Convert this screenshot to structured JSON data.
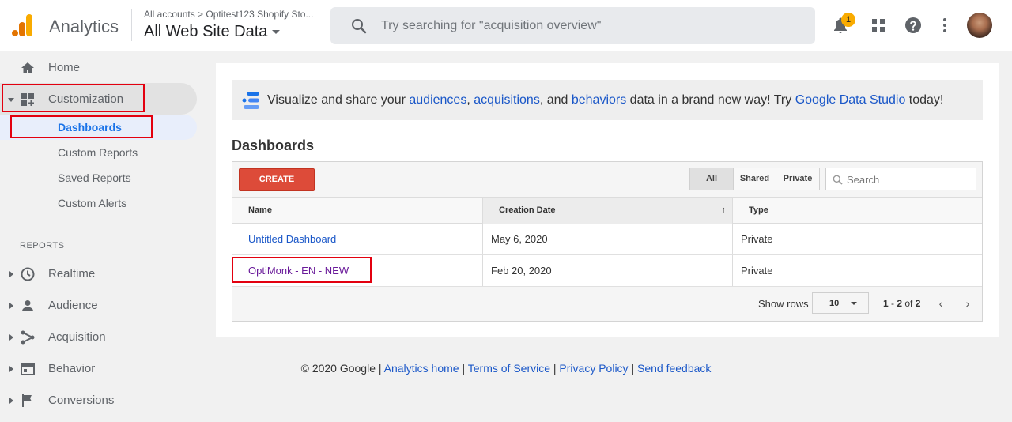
{
  "header": {
    "app_name": "Analytics",
    "breadcrumb": "All accounts > Optitest123 Shopify Sto...",
    "property": "All Web Site Data",
    "search_placeholder": "Try searching for \"acquisition overview\"",
    "notification_count": "1"
  },
  "sidebar": {
    "home": "Home",
    "customization": "Customization",
    "sub_items": [
      "Dashboards",
      "Custom Reports",
      "Saved Reports",
      "Custom Alerts"
    ],
    "reports_title": "REPORTS",
    "reports": [
      "Realtime",
      "Audience",
      "Acquisition",
      "Behavior",
      "Conversions"
    ]
  },
  "promo": {
    "prefix": "Visualize and share your ",
    "audiences": "audiences",
    "comma": ", ",
    "acquisitions": "acquisitions",
    "and": ", and ",
    "behaviors": "behaviors",
    "middle": " data in a brand new way! Try ",
    "studio": "Google Data Studio",
    "suffix": " today!"
  },
  "main": {
    "title": "Dashboards",
    "create_label": "CREATE",
    "filters": [
      "All",
      "Shared",
      "Private"
    ],
    "search_placeholder": "Search"
  },
  "table": {
    "columns": [
      "Name",
      "Creation Date",
      "Type"
    ],
    "sort_indicator": "↑",
    "rows": [
      {
        "name": "Untitled Dashboard",
        "date": "May 6, 2020",
        "type": "Private"
      },
      {
        "name": "OptiMonk - EN - NEW",
        "date": "Feb 20, 2020",
        "type": "Private"
      }
    ],
    "show_rows_label": "Show rows",
    "rows_value": "10",
    "range_from": "1",
    "range_sep": " - ",
    "range_to": "2",
    "range_of": " of ",
    "range_total": "2",
    "prev": "‹",
    "next": "›"
  },
  "footer": {
    "copyright": "© 2020 Google | ",
    "analytics_home": "Analytics home",
    "sep": " | ",
    "terms": "Terms of Service",
    "privacy": "Privacy Policy",
    "feedback": "Send feedback"
  },
  "colors": {
    "accent": "#1a73e8",
    "link": "#1a57c8",
    "create": "#dd4b39",
    "highlight": "#e3000f",
    "logo_orange": "#f9ab00",
    "logo_dark": "#e37400"
  }
}
